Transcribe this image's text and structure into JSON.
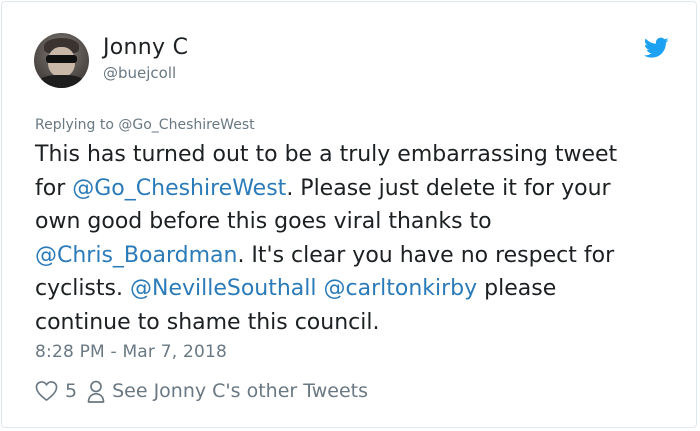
{
  "tweet": {
    "author": {
      "name": "Jonny C",
      "handle": "@buejcoll"
    },
    "replying_label": "Replying to",
    "replying_to": "@Go_CheshireWest",
    "lines": [
      [
        {
          "text": "This has turned out to be a truly embarrassing tweet"
        }
      ],
      [
        {
          "text": "for "
        },
        {
          "text": "@Go_CheshireWest",
          "mention": true
        },
        {
          "text": ". Please just delete it for your"
        }
      ],
      [
        {
          "text": "own good before this goes viral thanks to"
        }
      ],
      [
        {
          "text": "@Chris_Boardman",
          "mention": true
        },
        {
          "text": ". It's clear you have no respect for"
        }
      ],
      [
        {
          "text": "cyclists. "
        },
        {
          "text": "@NevilleSouthall",
          "mention": true
        },
        {
          "text": " "
        },
        {
          "text": "@carltonkirby",
          "mention": true
        },
        {
          "text": " please"
        }
      ],
      [
        {
          "text": "continue to shame this council."
        }
      ]
    ],
    "timestamp": "8:28 PM - Mar 7, 2018",
    "likes": "5",
    "other_tweets_label": "See Jonny C's other Tweets"
  },
  "icons": {
    "logo": "twitter-bird-icon",
    "like": "heart-icon",
    "profile": "person-icon"
  },
  "colors": {
    "text": "#1c2022",
    "muted": "#697882",
    "link": "#2b7bb9",
    "brand": "#1da1f2",
    "border": "#e1e8ed"
  }
}
